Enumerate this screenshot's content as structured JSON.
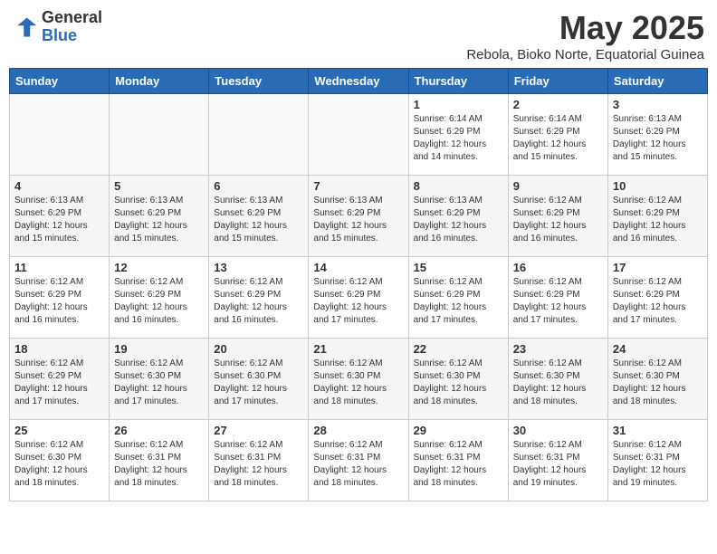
{
  "header": {
    "logo_general": "General",
    "logo_blue": "Blue",
    "month_year": "May 2025",
    "location": "Rebola, Bioko Norte, Equatorial Guinea"
  },
  "days_of_week": [
    "Sunday",
    "Monday",
    "Tuesday",
    "Wednesday",
    "Thursday",
    "Friday",
    "Saturday"
  ],
  "weeks": [
    {
      "alt": false,
      "days": [
        {
          "number": "",
          "info": ""
        },
        {
          "number": "",
          "info": ""
        },
        {
          "number": "",
          "info": ""
        },
        {
          "number": "",
          "info": ""
        },
        {
          "number": "1",
          "info": "Sunrise: 6:14 AM\nSunset: 6:29 PM\nDaylight: 12 hours\nand 14 minutes."
        },
        {
          "number": "2",
          "info": "Sunrise: 6:14 AM\nSunset: 6:29 PM\nDaylight: 12 hours\nand 15 minutes."
        },
        {
          "number": "3",
          "info": "Sunrise: 6:13 AM\nSunset: 6:29 PM\nDaylight: 12 hours\nand 15 minutes."
        }
      ]
    },
    {
      "alt": true,
      "days": [
        {
          "number": "4",
          "info": "Sunrise: 6:13 AM\nSunset: 6:29 PM\nDaylight: 12 hours\nand 15 minutes."
        },
        {
          "number": "5",
          "info": "Sunrise: 6:13 AM\nSunset: 6:29 PM\nDaylight: 12 hours\nand 15 minutes."
        },
        {
          "number": "6",
          "info": "Sunrise: 6:13 AM\nSunset: 6:29 PM\nDaylight: 12 hours\nand 15 minutes."
        },
        {
          "number": "7",
          "info": "Sunrise: 6:13 AM\nSunset: 6:29 PM\nDaylight: 12 hours\nand 15 minutes."
        },
        {
          "number": "8",
          "info": "Sunrise: 6:13 AM\nSunset: 6:29 PM\nDaylight: 12 hours\nand 16 minutes."
        },
        {
          "number": "9",
          "info": "Sunrise: 6:12 AM\nSunset: 6:29 PM\nDaylight: 12 hours\nand 16 minutes."
        },
        {
          "number": "10",
          "info": "Sunrise: 6:12 AM\nSunset: 6:29 PM\nDaylight: 12 hours\nand 16 minutes."
        }
      ]
    },
    {
      "alt": false,
      "days": [
        {
          "number": "11",
          "info": "Sunrise: 6:12 AM\nSunset: 6:29 PM\nDaylight: 12 hours\nand 16 minutes."
        },
        {
          "number": "12",
          "info": "Sunrise: 6:12 AM\nSunset: 6:29 PM\nDaylight: 12 hours\nand 16 minutes."
        },
        {
          "number": "13",
          "info": "Sunrise: 6:12 AM\nSunset: 6:29 PM\nDaylight: 12 hours\nand 16 minutes."
        },
        {
          "number": "14",
          "info": "Sunrise: 6:12 AM\nSunset: 6:29 PM\nDaylight: 12 hours\nand 17 minutes."
        },
        {
          "number": "15",
          "info": "Sunrise: 6:12 AM\nSunset: 6:29 PM\nDaylight: 12 hours\nand 17 minutes."
        },
        {
          "number": "16",
          "info": "Sunrise: 6:12 AM\nSunset: 6:29 PM\nDaylight: 12 hours\nand 17 minutes."
        },
        {
          "number": "17",
          "info": "Sunrise: 6:12 AM\nSunset: 6:29 PM\nDaylight: 12 hours\nand 17 minutes."
        }
      ]
    },
    {
      "alt": true,
      "days": [
        {
          "number": "18",
          "info": "Sunrise: 6:12 AM\nSunset: 6:29 PM\nDaylight: 12 hours\nand 17 minutes."
        },
        {
          "number": "19",
          "info": "Sunrise: 6:12 AM\nSunset: 6:30 PM\nDaylight: 12 hours\nand 17 minutes."
        },
        {
          "number": "20",
          "info": "Sunrise: 6:12 AM\nSunset: 6:30 PM\nDaylight: 12 hours\nand 17 minutes."
        },
        {
          "number": "21",
          "info": "Sunrise: 6:12 AM\nSunset: 6:30 PM\nDaylight: 12 hours\nand 18 minutes."
        },
        {
          "number": "22",
          "info": "Sunrise: 6:12 AM\nSunset: 6:30 PM\nDaylight: 12 hours\nand 18 minutes."
        },
        {
          "number": "23",
          "info": "Sunrise: 6:12 AM\nSunset: 6:30 PM\nDaylight: 12 hours\nand 18 minutes."
        },
        {
          "number": "24",
          "info": "Sunrise: 6:12 AM\nSunset: 6:30 PM\nDaylight: 12 hours\nand 18 minutes."
        }
      ]
    },
    {
      "alt": false,
      "days": [
        {
          "number": "25",
          "info": "Sunrise: 6:12 AM\nSunset: 6:30 PM\nDaylight: 12 hours\nand 18 minutes."
        },
        {
          "number": "26",
          "info": "Sunrise: 6:12 AM\nSunset: 6:31 PM\nDaylight: 12 hours\nand 18 minutes."
        },
        {
          "number": "27",
          "info": "Sunrise: 6:12 AM\nSunset: 6:31 PM\nDaylight: 12 hours\nand 18 minutes."
        },
        {
          "number": "28",
          "info": "Sunrise: 6:12 AM\nSunset: 6:31 PM\nDaylight: 12 hours\nand 18 minutes."
        },
        {
          "number": "29",
          "info": "Sunrise: 6:12 AM\nSunset: 6:31 PM\nDaylight: 12 hours\nand 18 minutes."
        },
        {
          "number": "30",
          "info": "Sunrise: 6:12 AM\nSunset: 6:31 PM\nDaylight: 12 hours\nand 19 minutes."
        },
        {
          "number": "31",
          "info": "Sunrise: 6:12 AM\nSunset: 6:31 PM\nDaylight: 12 hours\nand 19 minutes."
        }
      ]
    }
  ]
}
